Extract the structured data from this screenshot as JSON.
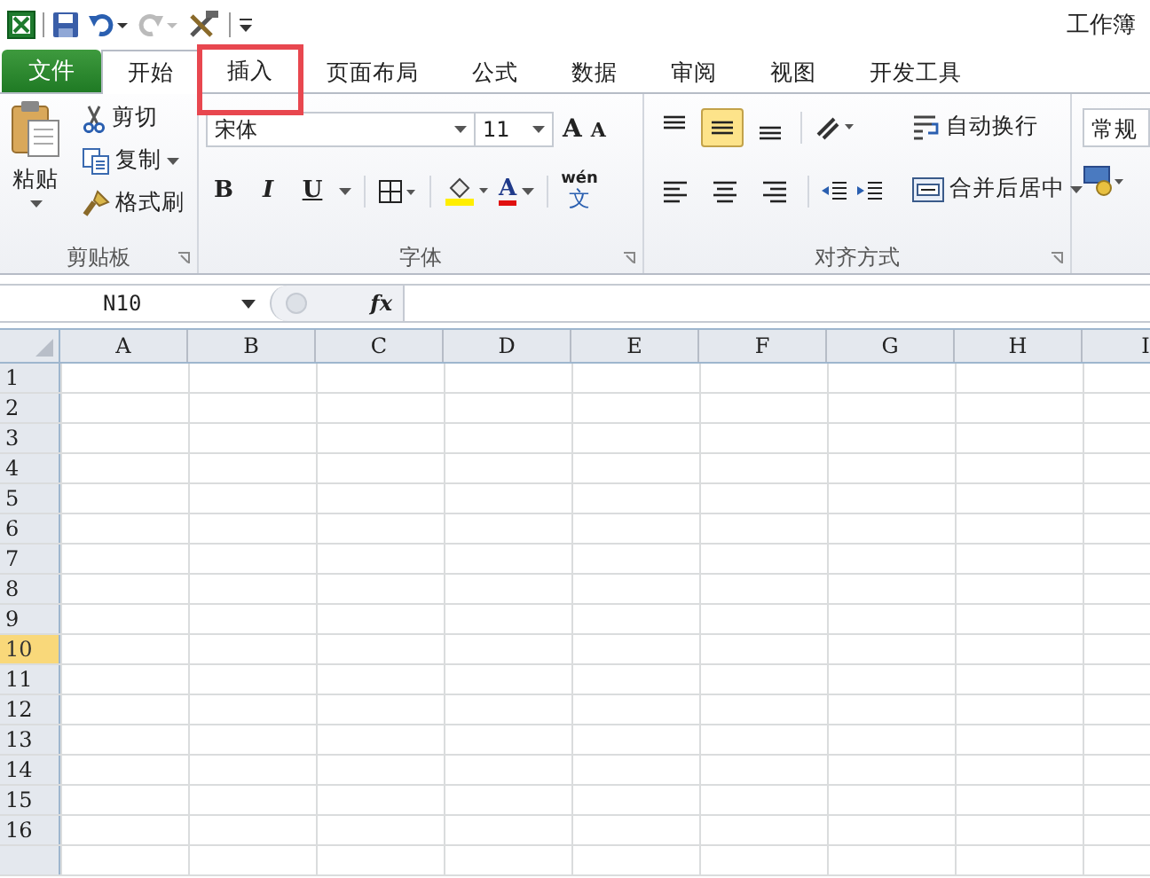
{
  "title": "工作簿",
  "file_tab": "文件",
  "tabs": [
    {
      "label": "开始",
      "selected": true,
      "highlighted": false
    },
    {
      "label": "插入",
      "selected": false,
      "highlighted": true
    },
    {
      "label": "页面布局",
      "selected": false,
      "highlighted": false
    },
    {
      "label": "公式",
      "selected": false,
      "highlighted": false
    },
    {
      "label": "数据",
      "selected": false,
      "highlighted": false
    },
    {
      "label": "审阅",
      "selected": false,
      "highlighted": false
    },
    {
      "label": "视图",
      "selected": false,
      "highlighted": false
    },
    {
      "label": "开发工具",
      "selected": false,
      "highlighted": false
    }
  ],
  "clipboard": {
    "label": "剪贴板",
    "paste": "粘贴",
    "items": [
      {
        "kind": "cut",
        "label": "剪切"
      },
      {
        "kind": "copy",
        "label": "复制"
      },
      {
        "kind": "painter",
        "label": "格式刷"
      }
    ]
  },
  "font": {
    "label": "字体",
    "font_name": "宋体",
    "font_size": "11",
    "grow": "A",
    "shrink": "A",
    "styles": [
      {
        "kind": "bold",
        "label": "B"
      },
      {
        "kind": "italic",
        "label": "I"
      },
      {
        "kind": "underline",
        "label": "U"
      }
    ],
    "font_color": "A",
    "phonetic_top": "wén",
    "phonetic_glyph": "文"
  },
  "alignment": {
    "label": "对齐方式",
    "vertical": [
      {
        "kind": "top",
        "selected": false
      },
      {
        "kind": "middle",
        "selected": true
      },
      {
        "kind": "bottom",
        "selected": false
      }
    ],
    "horizontal": [
      {
        "kind": "left",
        "selected": false
      },
      {
        "kind": "center",
        "selected": false
      },
      {
        "kind": "right",
        "selected": false
      }
    ],
    "wrap": "自动换行",
    "merge": "合并后居中"
  },
  "number": {
    "format": "常规"
  },
  "name_box": "N10",
  "fx": "fx",
  "columns": [
    "A",
    "B",
    "C",
    "D",
    "E",
    "F",
    "G",
    "H",
    "I"
  ],
  "rows": [
    {
      "label": "1",
      "selected": false
    },
    {
      "label": "2",
      "selected": false
    },
    {
      "label": "3",
      "selected": false
    },
    {
      "label": "4",
      "selected": false
    },
    {
      "label": "5",
      "selected": false
    },
    {
      "label": "6",
      "selected": false
    },
    {
      "label": "7",
      "selected": false
    },
    {
      "label": "8",
      "selected": false
    },
    {
      "label": "9",
      "selected": false
    },
    {
      "label": "10",
      "selected": true
    },
    {
      "label": "11",
      "selected": false
    },
    {
      "label": "12",
      "selected": false
    },
    {
      "label": "13",
      "selected": false
    },
    {
      "label": "14",
      "selected": false
    },
    {
      "label": "15",
      "selected": false
    },
    {
      "label": "16",
      "selected": false
    }
  ]
}
